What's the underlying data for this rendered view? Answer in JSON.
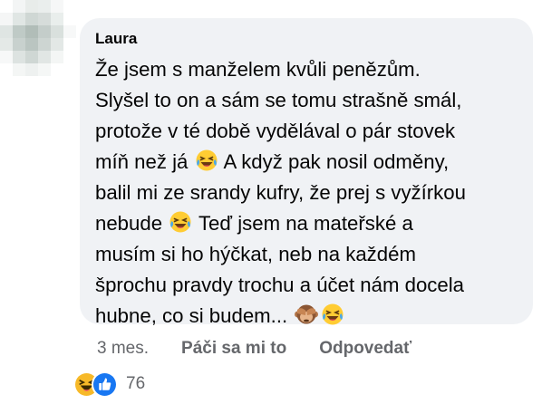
{
  "comment": {
    "author": "Laura",
    "lines": [
      {
        "pre": "Že jsem s manželem kvůli penězům.",
        "post": ""
      },
      {
        "pre": "Slyšel to on a sám se tomu strašně smál,",
        "post": ""
      },
      {
        "pre": "protože v té době vydělával o pár stovek",
        "post": ""
      },
      {
        "pre": "míň než já ",
        "post": " A když pak nosil odměny,"
      },
      {
        "pre": "balil mi ze srandy kufry, že prej s vyžírkou",
        "post": ""
      },
      {
        "pre": "nebude ",
        "post": " Teď jsem na mateřské a"
      },
      {
        "pre": "musím si ho hýčkat, neb na každém",
        "post": ""
      },
      {
        "pre": "šprochu pravdy trochu a účet nám docela",
        "post": ""
      },
      {
        "pre": "hubne, co si budem... ",
        "post": ""
      }
    ],
    "emoji": [
      "laughing-crying-emoji",
      "see-no-evil-monkey-emoji"
    ]
  },
  "actions": {
    "time": "3 mes.",
    "like_label": "Páči sa mi to",
    "reply_label": "Odpovedať"
  },
  "reactions": {
    "count": "76",
    "icons": [
      "haha-reaction-icon",
      "like-reaction-icon"
    ],
    "colors": {
      "like": "#1877f2",
      "haha": "#f7b928"
    }
  }
}
